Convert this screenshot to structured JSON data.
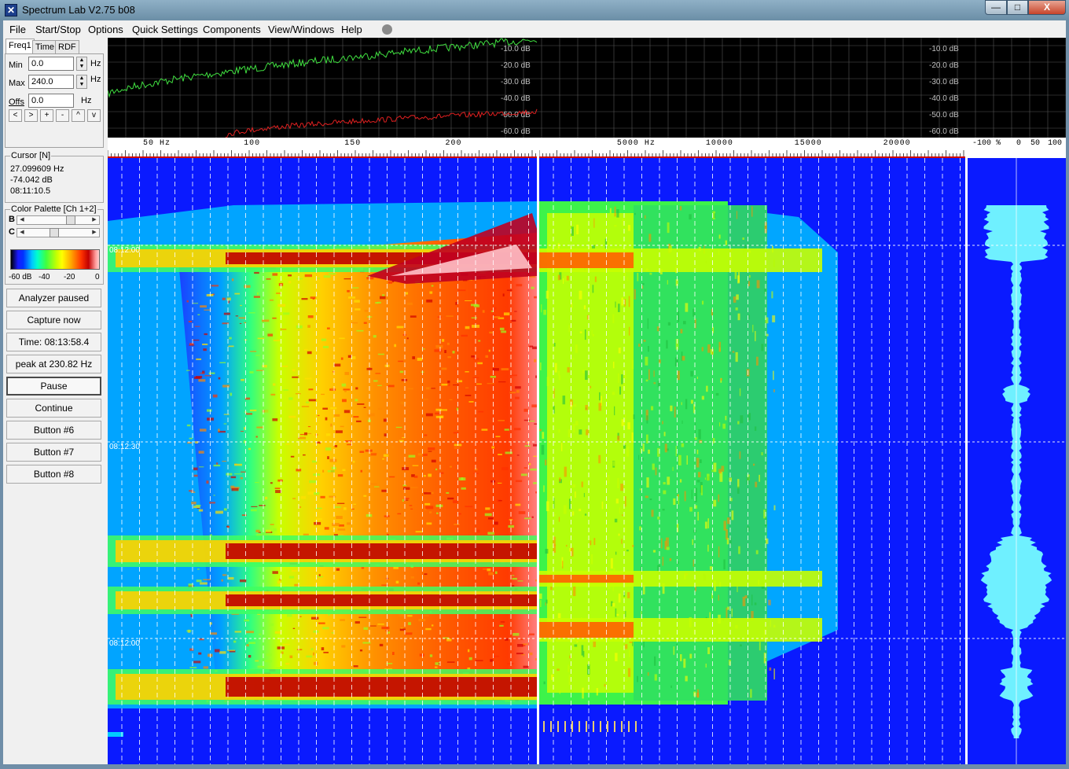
{
  "window": {
    "title": "Spectrum Lab V2.75 b08",
    "min_glyph": "—",
    "max_glyph": "□",
    "close_glyph": "X"
  },
  "menu": {
    "items": [
      {
        "label": "File"
      },
      {
        "label": "Start/Stop"
      },
      {
        "label": "Options"
      },
      {
        "label": "Quick Settings"
      },
      {
        "label": "Components"
      },
      {
        "label": "View/Windows"
      },
      {
        "label": "Help"
      }
    ]
  },
  "left_panel": {
    "tabs": [
      "Freq1",
      "Time",
      "RDF"
    ],
    "min_label": "Min",
    "min_value": "0.0",
    "min_unit": "Hz",
    "max_label": "Max",
    "max_value": "240.0",
    "max_unit": "Hz",
    "offs_label": "Offs",
    "offs_value": "0.0",
    "offs_unit": "Hz",
    "nav_buttons": [
      "<",
      ">",
      "+",
      "-",
      "^",
      "v"
    ],
    "cursor": {
      "title": "Cursor [N]",
      "freq": "27.099609 Hz",
      "level": "-74.042 dB",
      "time": "08:11:10.5"
    },
    "palette": {
      "title": "Color Palette [Ch 1+2]",
      "b_label": "B",
      "c_label": "C",
      "brightness": 0.72,
      "contrast": 0.42,
      "ticks": [
        "-60 dB",
        "-40",
        "-20",
        "0"
      ]
    },
    "buttons": [
      {
        "label": "Analyzer paused",
        "pressed": false
      },
      {
        "label": "Capture now",
        "pressed": false
      },
      {
        "label": "Time:  08:13:58.4",
        "pressed": false
      },
      {
        "label": "peak at 230.82 Hz",
        "pressed": false
      },
      {
        "label": "Pause",
        "pressed": true
      },
      {
        "label": "Continue",
        "pressed": false
      },
      {
        "label": "Button #6",
        "pressed": false
      },
      {
        "label": "Button #7",
        "pressed": false
      },
      {
        "label": "Button #8",
        "pressed": false
      }
    ]
  },
  "display": {
    "db_labels": [
      "-10.0 dB",
      "-20.0 dB",
      "-30.0 dB",
      "-40.0 dB",
      "-50.0 dB",
      "-60.0 dB"
    ],
    "scale1": [
      "50  Hz",
      "100",
      "150",
      "200"
    ],
    "scale1_values": [
      50,
      100,
      150,
      200
    ],
    "scale1_range": [
      27,
      240
    ],
    "scale2": [
      "5000  Hz",
      "10000",
      "15000",
      "20000"
    ],
    "scale2_values": [
      5000,
      10000,
      15000,
      20000
    ],
    "scale2_range": [
      0,
      24000
    ],
    "scale3": [
      "-100  %",
      "0",
      "50",
      "100"
    ],
    "time_labels": [
      "08:12:00",
      "08:12:30",
      "08:12:00"
    ],
    "colors": {
      "waterfall_bg": "#0a1aff",
      "trace_green": "#40e040",
      "trace_red": "#e02020",
      "grid": "#555555",
      "scope": "#6ff0ff"
    }
  }
}
